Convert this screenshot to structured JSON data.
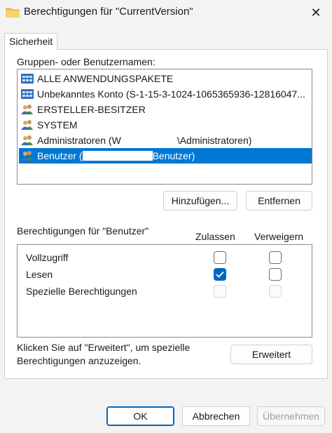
{
  "window": {
    "title": "Berechtigungen für \"CurrentVersion\"",
    "close_glyph": "✕"
  },
  "tab": {
    "label": "Sicherheit"
  },
  "groups": {
    "label": "Gruppen- oder Benutzernamen:",
    "items": [
      {
        "icon": "app-package-icon",
        "label": "ALLE ANWENDUNGSPAKETE"
      },
      {
        "icon": "app-package-icon",
        "label": "Unbekanntes Konto (S-1-15-3-1024-1065365936-12816047..."
      },
      {
        "icon": "users-group-icon",
        "label": "ERSTELLER-BESITZER"
      },
      {
        "icon": "users-group-icon",
        "label": "SYSTEM"
      },
      {
        "icon": "users-group-icon",
        "label_start": "Administratoren (W",
        "label_end": "\\Administratoren)"
      },
      {
        "icon": "users-group-icon",
        "label_start": "Benutzer (",
        "label_end": "Benutzer)",
        "selected": true
      }
    ]
  },
  "buttons": {
    "add": "Hinzufügen...",
    "remove": "Entfernen",
    "advanced": "Erweitert",
    "ok": "OK",
    "cancel": "Abbrechen",
    "apply": "Übernehmen"
  },
  "permissions": {
    "label": "Berechtigungen für \"Benutzer\"",
    "allow_header": "Zulassen",
    "deny_header": "Verweigern",
    "rows": [
      {
        "label": "Vollzugriff",
        "allow": false,
        "deny": false,
        "disabled": false
      },
      {
        "label": "Lesen",
        "allow": true,
        "deny": false,
        "disabled": false
      },
      {
        "label": "Spezielle Berechtigungen",
        "allow": false,
        "deny": false,
        "disabled": true
      }
    ]
  },
  "advanced_hint": {
    "line1": "Klicken Sie auf \"Erweitert\", um spezielle",
    "line2": "Berechtigungen anzuzeigen."
  },
  "colors": {
    "accent": "#0067c0",
    "selection": "#0078d4"
  }
}
